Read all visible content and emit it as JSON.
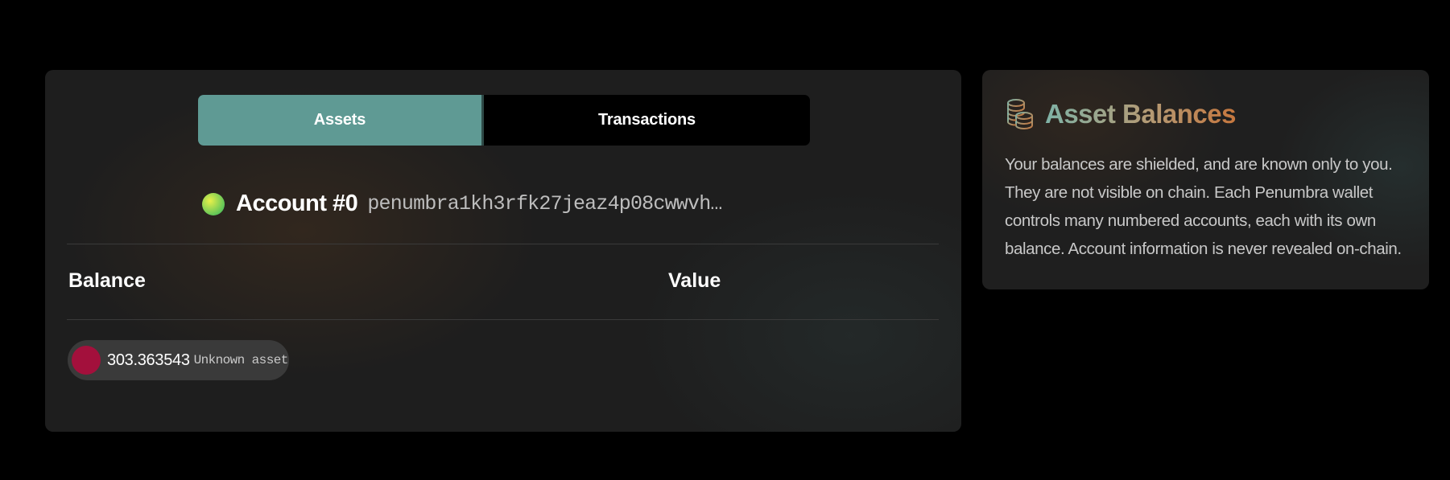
{
  "tabs": {
    "assets": "Assets",
    "transactions": "Transactions",
    "active": "Assets"
  },
  "account": {
    "name": "Account #0",
    "address": "penumbra1kh3rfk27jeaz4p08cwwvh…"
  },
  "table": {
    "headers": {
      "balance": "Balance",
      "value": "Value"
    },
    "rows": [
      {
        "amount": "303.363543",
        "asset": "Unknown asset",
        "value": ""
      }
    ]
  },
  "info": {
    "title": "Asset Balances",
    "icon": "coins-icon",
    "text": "Your balances are shielded, and are known only to you. They are not visible on chain. Each Penumbra wallet controls many numbered accounts, each with its own balance. Account information is never revealed on-chain."
  },
  "colors": {
    "active_tab": "#5f9a94",
    "asset_icon": "#a3103c",
    "title_gradient": [
      "#7fb3a7",
      "#b59a74",
      "#c6773e"
    ]
  }
}
